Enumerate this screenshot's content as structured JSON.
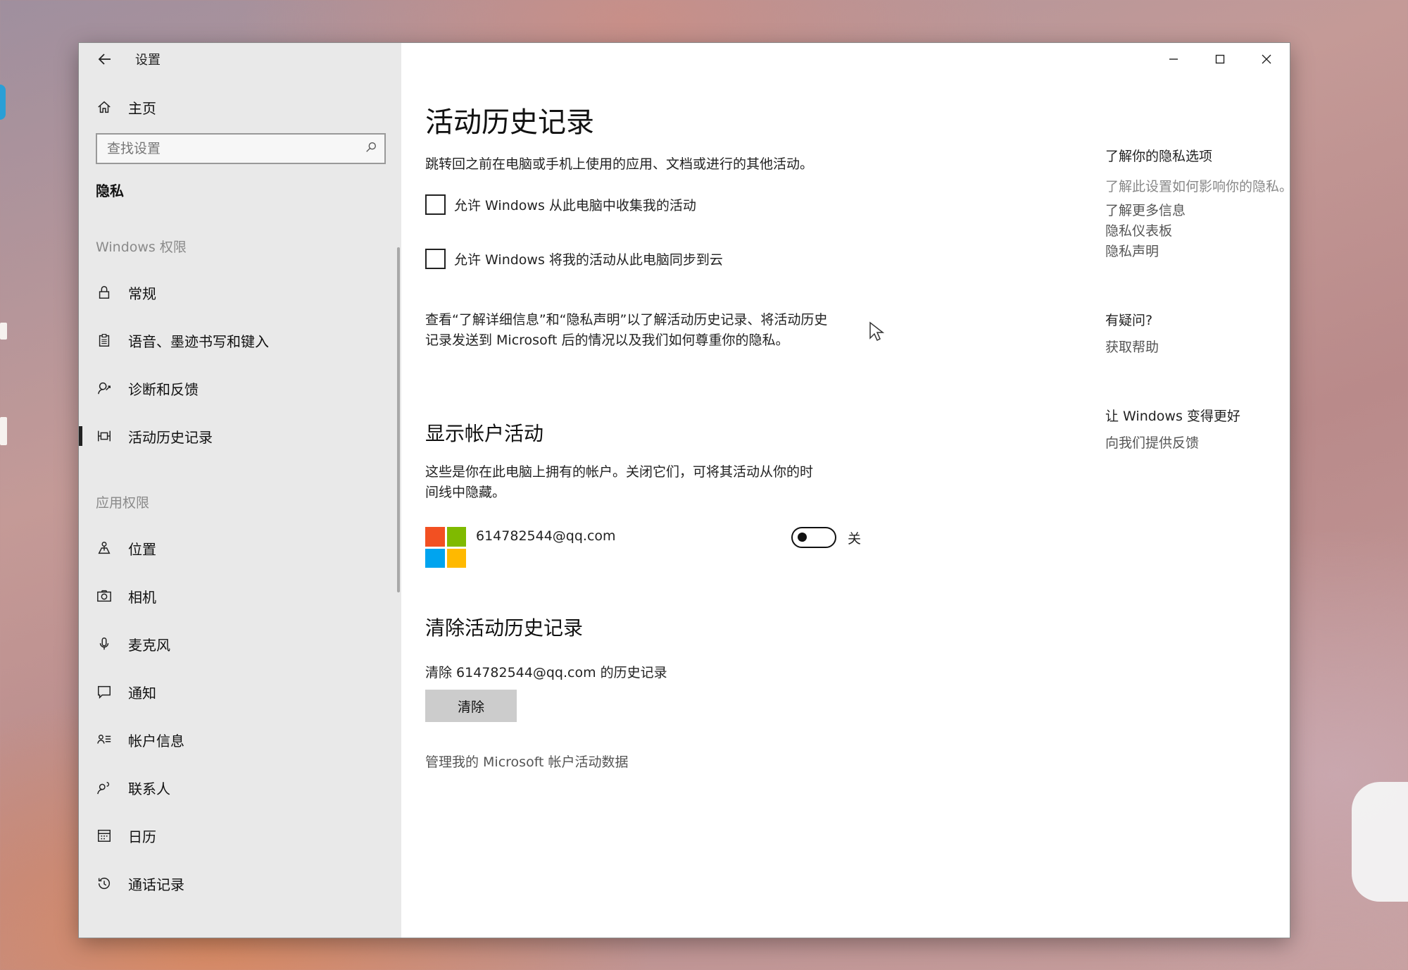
{
  "window": {
    "title": "设置",
    "controls": {
      "minimize": "minimize-icon",
      "maximize": "maximize-icon",
      "close": "close-icon"
    }
  },
  "sidebar": {
    "home_label": "主页",
    "search_placeholder": "查找设置",
    "current_section": "隐私",
    "group_windows": "Windows 权限",
    "windows_items": [
      {
        "label": "常规",
        "icon": "lock-icon"
      },
      {
        "label": "语音、墨迹书写和键入",
        "icon": "clipboard-icon"
      },
      {
        "label": "诊断和反馈",
        "icon": "feedback-icon"
      },
      {
        "label": "活动历史记录",
        "icon": "timeline-icon",
        "active": true
      }
    ],
    "group_apps": "应用权限",
    "app_items": [
      {
        "label": "位置",
        "icon": "location-icon"
      },
      {
        "label": "相机",
        "icon": "camera-icon"
      },
      {
        "label": "麦克风",
        "icon": "microphone-icon"
      },
      {
        "label": "通知",
        "icon": "notification-icon"
      },
      {
        "label": "帐户信息",
        "icon": "account-info-icon"
      },
      {
        "label": "联系人",
        "icon": "contacts-icon"
      },
      {
        "label": "日历",
        "icon": "calendar-icon"
      },
      {
        "label": "通话记录",
        "icon": "history-icon"
      }
    ]
  },
  "main": {
    "title": "活动历史记录",
    "description": "跳转回之前在电脑或手机上使用的应用、文档或进行的其他活动。",
    "checkbox1": {
      "label": "允许 Windows 从此电脑中收集我的活动",
      "checked": false
    },
    "checkbox2": {
      "label": "允许 Windows 将我的活动从此电脑同步到云",
      "checked": false
    },
    "privacy_note_line1": "查看“了解详细信息”和“隐私声明”以了解活动历史记录、将活动历史",
    "privacy_note_line2": "记录发送到 Microsoft 后的情况以及我们如何尊重你的隐私。",
    "show_accounts_heading": "显示帐户活动",
    "show_accounts_desc_line1": "这些是你在此电脑上拥有的帐户。关闭它们，可将其活动从你的时",
    "show_accounts_desc_line2": "间线中隐藏。",
    "account": {
      "email": "614782544@qq.com",
      "toggle_state": "关",
      "toggle_on": false
    },
    "clear_heading": "清除活动历史记录",
    "clear_desc": "清除 614782544@qq.com 的历史记录",
    "clear_button": "清除",
    "manage_link": "管理我的 Microsoft 帐户活动数据"
  },
  "right": {
    "learn_title": "了解你的隐私选项",
    "learn_sub": "了解此设置如何影响你的隐私。",
    "links": [
      "了解更多信息",
      "隐私仪表板",
      "隐私声明"
    ],
    "question_title": "有疑问?",
    "help_link": "获取帮助",
    "improve_title": "让 Windows 变得更好",
    "feedback_link": "向我们提供反馈"
  },
  "colors": {
    "ms_red": "#f25022",
    "ms_green": "#7fba00",
    "ms_blue": "#00a4ef",
    "ms_yellow": "#ffb900",
    "sidebar_bg": "#e9e9e9"
  }
}
